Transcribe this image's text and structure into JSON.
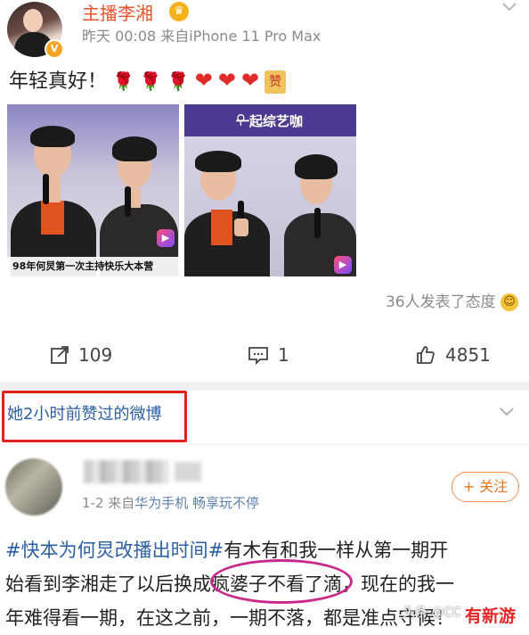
{
  "post": {
    "author_name": "主播李湘",
    "verified_badge": "V",
    "crown_badge": "♛",
    "time_source": "昨天 00:08  来自iPhone 11 Pro Max",
    "text": "年轻真好！",
    "emojis": [
      "rose",
      "rose",
      "rose",
      "heart",
      "heart",
      "heart",
      "zan"
    ],
    "zan_label": "赞",
    "images": [
      {
        "caption": "98年何炅第一次主持快乐大本营"
      },
      {
        "banner": "一起综艺咖"
      }
    ],
    "attitudes_text": "36人发表了态度",
    "actions": {
      "share_count": "109",
      "comment_count": "1",
      "like_count": "4851"
    }
  },
  "liked_section": {
    "title": "她2小时前赞过的微博"
  },
  "liked_post": {
    "meta_prefix": "1-2  来自",
    "device": "华为手机 畅享玩不停",
    "follow_label": "+ 关注",
    "hashtag": "#快本为何炅改播出时间#",
    "line1_rest": "有木有和我一样从第一期开",
    "line2": "始看到李湘走了以后换成疯婆子不看了滴，现在的我一",
    "line3": "年难得看一期，在这之前，一期不落，都是准点守候！"
  },
  "watermark": {
    "text": "头条 @CC",
    "logo": "有新游"
  },
  "colors": {
    "author": "#e8552d",
    "link": "#2b5fa6",
    "highlight_box": "#e0221b",
    "ellipse": "#c8298a",
    "follow": "#e8741f"
  }
}
